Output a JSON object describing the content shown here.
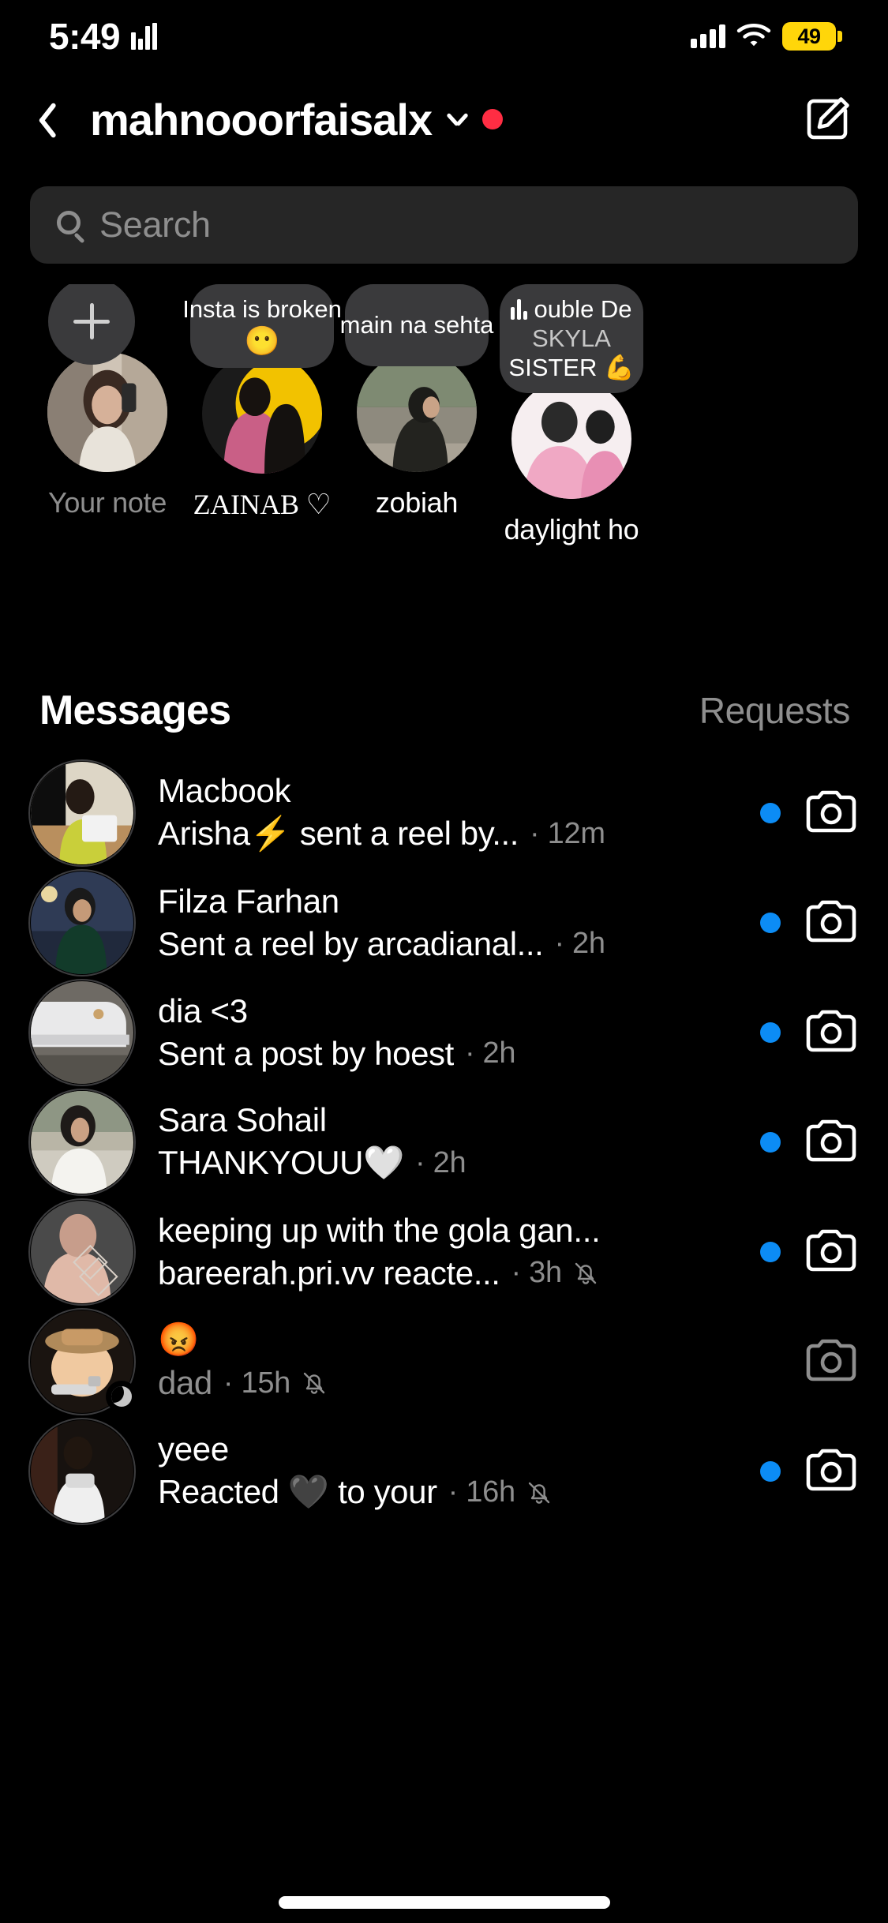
{
  "status_bar": {
    "time": "5:49",
    "recording_icon": "audio-bars-icon",
    "signal_icon": "cellular-signal-icon",
    "wifi_icon": "wifi-icon",
    "battery_percent": "49",
    "battery_color": "#FFD60A"
  },
  "header": {
    "back_icon": "chevron-left-icon",
    "username": "mahnooorfaisalx",
    "dropdown_icon": "chevron-down-icon",
    "status_dot_color": "#FF2D43",
    "compose_icon": "compose-icon"
  },
  "search": {
    "icon": "search-icon",
    "placeholder": "Search",
    "value": ""
  },
  "notes": [
    {
      "type": "add",
      "icon": "plus-icon",
      "label": "Your note",
      "label_muted": true,
      "bubble_text": "",
      "bubble_emoji": ""
    },
    {
      "type": "note",
      "label": "ZAINAB ♡",
      "label_muted": false,
      "bubble_text": "Insta is broken",
      "bubble_emoji": "😶"
    },
    {
      "type": "note",
      "label": "zobiah",
      "label_muted": false,
      "bubble_text": "main na sehta",
      "bubble_emoji": ""
    },
    {
      "type": "music-note",
      "label": "daylight ho",
      "label_muted": false,
      "music_icon": "music-bars-icon",
      "bubble_text": "ouble De",
      "bubble_line2": "SKYLA",
      "bubble_line3": "SISTER 💪"
    }
  ],
  "messages_section": {
    "title": "Messages",
    "requests_label": "Requests"
  },
  "conversations": [
    {
      "name": "Macbook",
      "preview": "Arisha⚡ sent a reel by...",
      "meta": "· 12m",
      "unread": true,
      "muted": false,
      "preview_dim": false,
      "camera_icon": "camera-icon",
      "camera_active": true,
      "moon_badge": false
    },
    {
      "name": "Filza Farhan",
      "preview": "Sent a reel by arcadianal...",
      "meta": "· 2h",
      "unread": true,
      "muted": false,
      "preview_dim": false,
      "camera_icon": "camera-icon",
      "camera_active": true,
      "moon_badge": false
    },
    {
      "name": "dia <3",
      "preview": "Sent a post by hoest",
      "meta": "· 2h",
      "unread": true,
      "muted": false,
      "preview_dim": false,
      "camera_icon": "camera-icon",
      "camera_active": true,
      "moon_badge": false
    },
    {
      "name": "Sara Sohail",
      "preview": "THANKYOUU🤍",
      "meta": "· 2h",
      "unread": true,
      "muted": false,
      "preview_dim": false,
      "camera_icon": "camera-icon",
      "camera_active": true,
      "moon_badge": false
    },
    {
      "name": "keeping up with the gola gan...",
      "preview": "bareerah.pri.vv reacte...",
      "meta": "· 3h",
      "unread": true,
      "muted": true,
      "preview_dim": false,
      "camera_icon": "camera-icon",
      "camera_active": true,
      "moon_badge": false
    },
    {
      "name": "😡",
      "preview": "dad",
      "meta": "· 15h",
      "unread": false,
      "muted": true,
      "preview_dim": true,
      "camera_icon": "camera-icon",
      "camera_active": false,
      "moon_badge": true
    },
    {
      "name": "yeee",
      "preview": "Reacted 🖤 to your",
      "meta": "· 16h",
      "unread": true,
      "muted": true,
      "preview_dim": false,
      "camera_icon": "camera-icon",
      "camera_active": true,
      "moon_badge": false
    }
  ],
  "colors": {
    "background": "#000000",
    "unread_blue": "#0C8CF5",
    "search_bg": "#262626",
    "bubble_bg": "#3A3A3C",
    "secondary_text": "#8E8E8E"
  }
}
